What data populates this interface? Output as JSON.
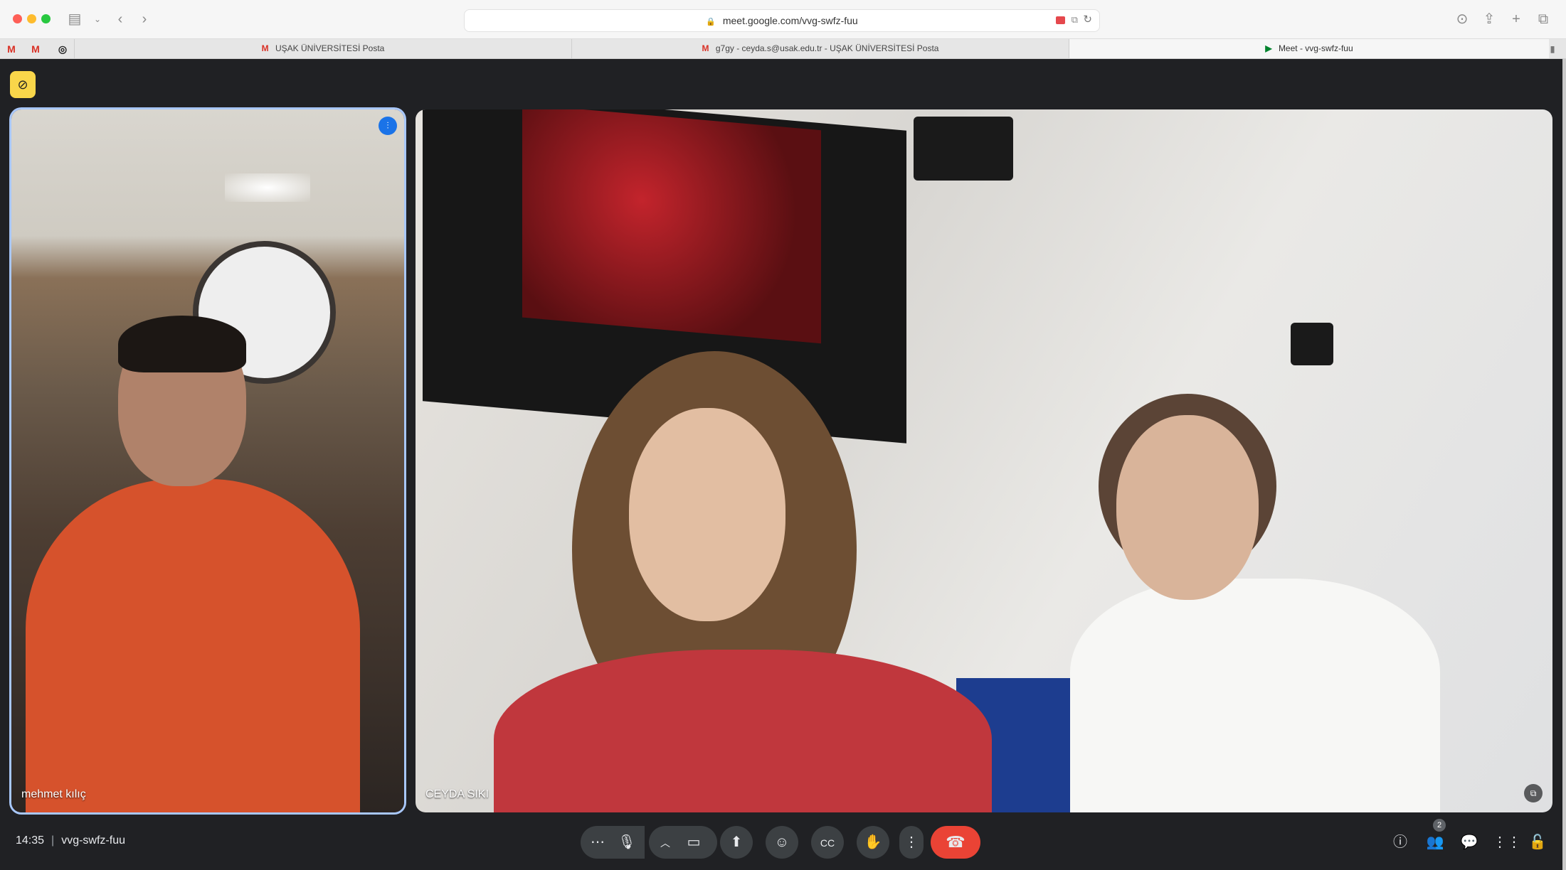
{
  "browser": {
    "url": "meet.google.com/vvg-swfz-fuu",
    "tabs": [
      {
        "label": "UŞAK ÜNİVERSİTESİ Posta"
      },
      {
        "label": "g7gy - ceyda.s@usak.edu.tr - UŞAK ÜNİVERSİTESİ Posta"
      },
      {
        "label": "Meet - vvg-swfz-fuu"
      }
    ]
  },
  "meeting": {
    "time": "14:35",
    "code": "vvg-swfz-fuu",
    "participants_count": "2"
  },
  "tiles": [
    {
      "name": "mehmet kılıç"
    },
    {
      "name": "CEYDA SIKI"
    }
  ],
  "colors": {
    "meet_bg": "#202124",
    "control_bg": "#3c4043",
    "end_call": "#ea4335",
    "active_speaker_border": "#a8c7fa",
    "host_badge": "#f9d64a"
  }
}
